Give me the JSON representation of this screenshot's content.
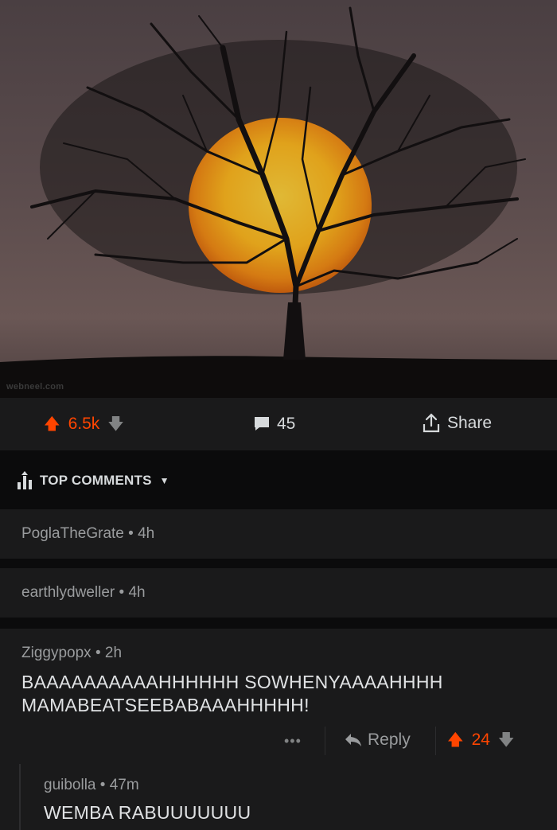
{
  "post": {
    "watermark": "webneel.com",
    "score": "6.5k",
    "comment_count": "45",
    "share_label": "Share"
  },
  "sort": {
    "label": "TOP COMMENTS"
  },
  "comments": [
    {
      "author": "PoglaTheGrate",
      "age": "4h"
    },
    {
      "author": "earthlydweller",
      "age": "4h"
    },
    {
      "author": "Ziggypopx",
      "age": "2h",
      "lines": [
        "BAAAAAAAAAAHHHHHH SOWHENYAAAAHHHH",
        "MAMABEATSEEBABAAAHHHHH!"
      ],
      "reply_label": "Reply",
      "more_label": "•••",
      "score": "24"
    },
    {
      "author": "guibolla",
      "age": "47m",
      "text": "WEMBA RABUUUUUUU"
    }
  ],
  "separator": "•",
  "colors": {
    "upvote": "#ff4500",
    "bg": "#0b0b0c",
    "card": "#1a1a1b"
  }
}
